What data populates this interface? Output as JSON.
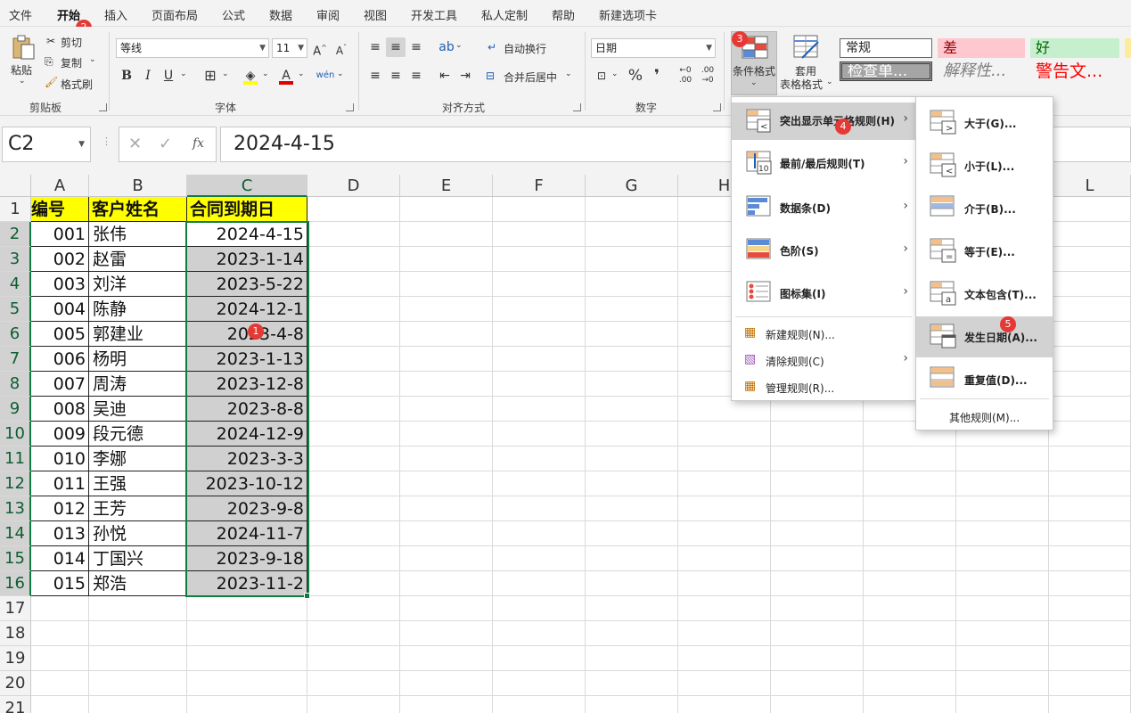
{
  "tabs": [
    "文件",
    "开始",
    "插入",
    "页面布局",
    "公式",
    "数据",
    "审阅",
    "视图",
    "开发工具",
    "私人定制",
    "帮助",
    "新建选项卡"
  ],
  "active_tab": "开始",
  "ribbon": {
    "clipboard": {
      "paste": "粘贴",
      "cut": "剪切",
      "copy": "复制",
      "format_painter": "格式刷",
      "label": "剪贴板"
    },
    "font": {
      "name": "等线",
      "size": "11",
      "bold": "B",
      "italic": "I",
      "underline": "U",
      "grow": "A^",
      "shrink": "Aˇ",
      "label": "字体"
    },
    "alignment": {
      "wrap": "自动换行",
      "merge": "合并后居中",
      "label": "对齐方式"
    },
    "number": {
      "format": "日期",
      "percent": "%",
      "comma": "❜",
      "label": "数字"
    },
    "styles": {
      "conditional": "条件格式",
      "table_format_1": "套用",
      "table_format_2": "表格格式",
      "normal": "常规",
      "bad": "差",
      "good": "好",
      "check_cell": "检查单...",
      "explanatory": "解释性...",
      "warning": "警告文..."
    }
  },
  "formula_bar": {
    "name_box": "C2",
    "fx": "fx",
    "value": "2024-4-15"
  },
  "columns": [
    "A",
    "B",
    "C",
    "D",
    "E",
    "F",
    "G",
    "H",
    "L"
  ],
  "rows": [
    "1",
    "2",
    "3",
    "4",
    "5",
    "6",
    "7",
    "8",
    "9",
    "10",
    "11",
    "12",
    "13",
    "14",
    "15",
    "16",
    "17",
    "18",
    "19",
    "20",
    "21"
  ],
  "table": {
    "headers": [
      "编号",
      "客户姓名",
      "合同到期日"
    ],
    "data": [
      [
        "001",
        "张伟",
        "2024-4-15"
      ],
      [
        "002",
        "赵雷",
        "2023-1-14"
      ],
      [
        "003",
        "刘洋",
        "2023-5-22"
      ],
      [
        "004",
        "陈静",
        "2024-12-1"
      ],
      [
        "005",
        "郭建业",
        "2023-4-8"
      ],
      [
        "006",
        "杨明",
        "2023-1-13"
      ],
      [
        "007",
        "周涛",
        "2023-12-8"
      ],
      [
        "008",
        "吴迪",
        "2023-8-8"
      ],
      [
        "009",
        "段元德",
        "2024-12-9"
      ],
      [
        "010",
        "李娜",
        "2023-3-3"
      ],
      [
        "011",
        "王强",
        "2023-10-12"
      ],
      [
        "012",
        "王芳",
        "2023-9-8"
      ],
      [
        "013",
        "孙悦",
        "2024-11-7"
      ],
      [
        "014",
        "丁国兴",
        "2023-9-18"
      ],
      [
        "015",
        "郑浩",
        "2023-11-2"
      ]
    ]
  },
  "cf_menu": {
    "items": [
      "突出显示单元格规则(H)",
      "最前/最后规则(T)",
      "数据条(D)",
      "色阶(S)",
      "图标集(I)"
    ],
    "actions": [
      "新建规则(N)...",
      "清除规则(C)",
      "管理规则(R)..."
    ]
  },
  "highlight_menu": {
    "items": [
      "大于(G)...",
      "小于(L)...",
      "介于(B)...",
      "等于(E)...",
      "文本包含(T)...",
      "发生日期(A)...",
      "重复值(D)..."
    ],
    "more": "其他规则(M)..."
  },
  "badges": [
    "1",
    "2",
    "3",
    "4",
    "5"
  ],
  "colors": {
    "accent": "#107c41",
    "header_fill": "#ffff00",
    "badge": "#e53935",
    "selection": "#d0d0d0"
  }
}
